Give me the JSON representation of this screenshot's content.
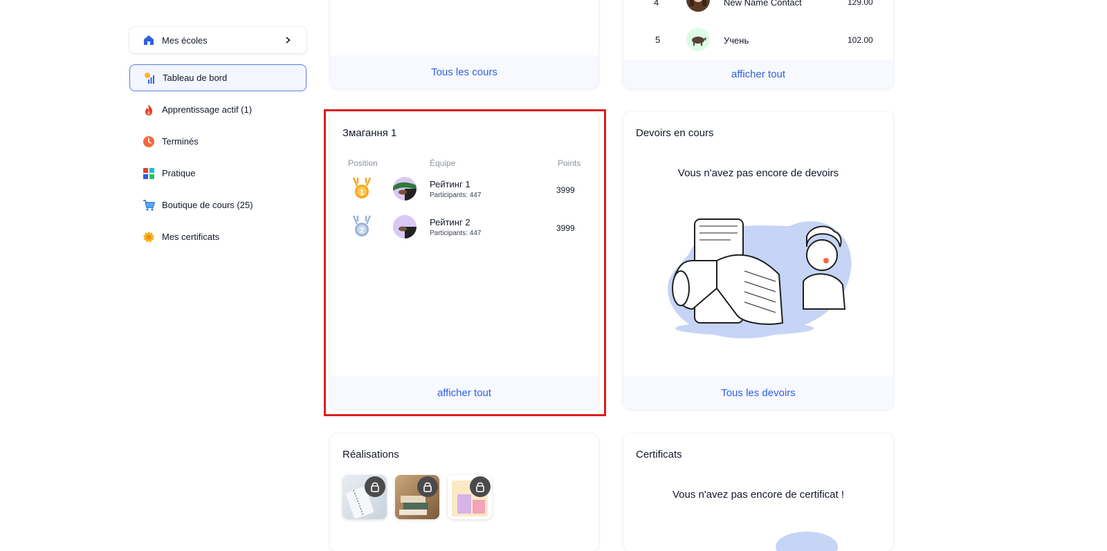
{
  "sidebar": {
    "schools_label": "Mes écoles",
    "items": [
      {
        "label": "Tableau de bord",
        "icon": "dashboard-icon",
        "active": true
      },
      {
        "label": "Apprentissage actif (1)",
        "icon": "fire-icon"
      },
      {
        "label": "Terminés",
        "icon": "clock-icon"
      },
      {
        "label": "Pratique",
        "icon": "grid-icon"
      },
      {
        "label": "Boutique de cours (25)",
        "icon": "cart-icon"
      },
      {
        "label": "Mes certificats",
        "icon": "certificate-icon"
      }
    ]
  },
  "courses_card": {
    "footer": "Tous les cours"
  },
  "leaderboard_card": {
    "rows": [
      {
        "position": "4",
        "name": "New Name Contact",
        "points": "129.00"
      },
      {
        "position": "5",
        "name": "Учень",
        "points": "102.00"
      }
    ],
    "footer": "afficher tout"
  },
  "competition_card": {
    "title": "Змагання 1",
    "headers": {
      "position": "Position",
      "team": "Équipe",
      "points": "Points"
    },
    "rows": [
      {
        "rank": "1",
        "name": "Рейтинг 1",
        "participants": "Participants: 447",
        "points": "3999"
      },
      {
        "rank": "2",
        "name": "Рейтинг 2",
        "participants": "Participants: 447",
        "points": "3999"
      }
    ],
    "footer": "afficher tout"
  },
  "homework_card": {
    "title": "Devoirs en cours",
    "empty": "Vous n'avez pas encore de devoirs",
    "footer": "Tous les devoirs"
  },
  "achievements_card": {
    "title": "Réalisations"
  },
  "certificates_card": {
    "title": "Certificats",
    "empty": "Vous n'avez pas encore de certificat !"
  },
  "colors": {
    "accent": "#2f5fe3",
    "highlight": "#e01b1b",
    "active_border": "#5a7be6",
    "gold": "#f5a623",
    "silver": "#9bb3d8"
  }
}
